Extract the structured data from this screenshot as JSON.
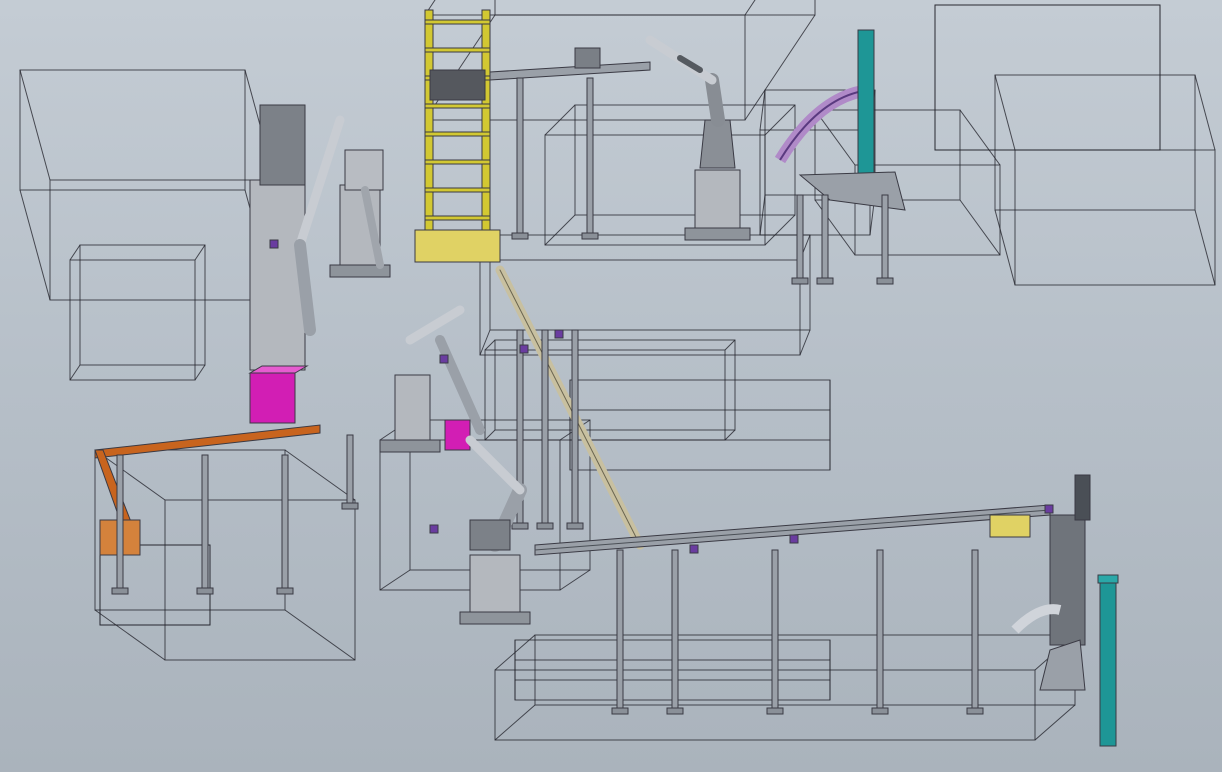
{
  "scene": {
    "type": "3d-cad-assembly-view",
    "background_top": "#c2cad2",
    "background_bottom": "#a9b2bb",
    "wireframe_color": "#1e1e26",
    "colors": {
      "orange_conveyor": "#c8641e",
      "magenta_cabinet": "#d21eb4",
      "yellow_tower": "#d2c832",
      "teal_column": "#1e9696",
      "steel": "#9aa0a8",
      "robot_gray": "#b4b8be",
      "rail_beige": "#c8c0a0",
      "accent_purple": "#6a3ca0",
      "yellow_plate": "#e0d264"
    },
    "components": [
      "enclosure-wireframe",
      "robot-arm",
      "robot-pedestal",
      "overhead-conveyor",
      "orange-conveyor",
      "magenta-cabinet",
      "yellow-lift-tower",
      "teal-column",
      "diagonal-rail",
      "curved-chute"
    ]
  }
}
